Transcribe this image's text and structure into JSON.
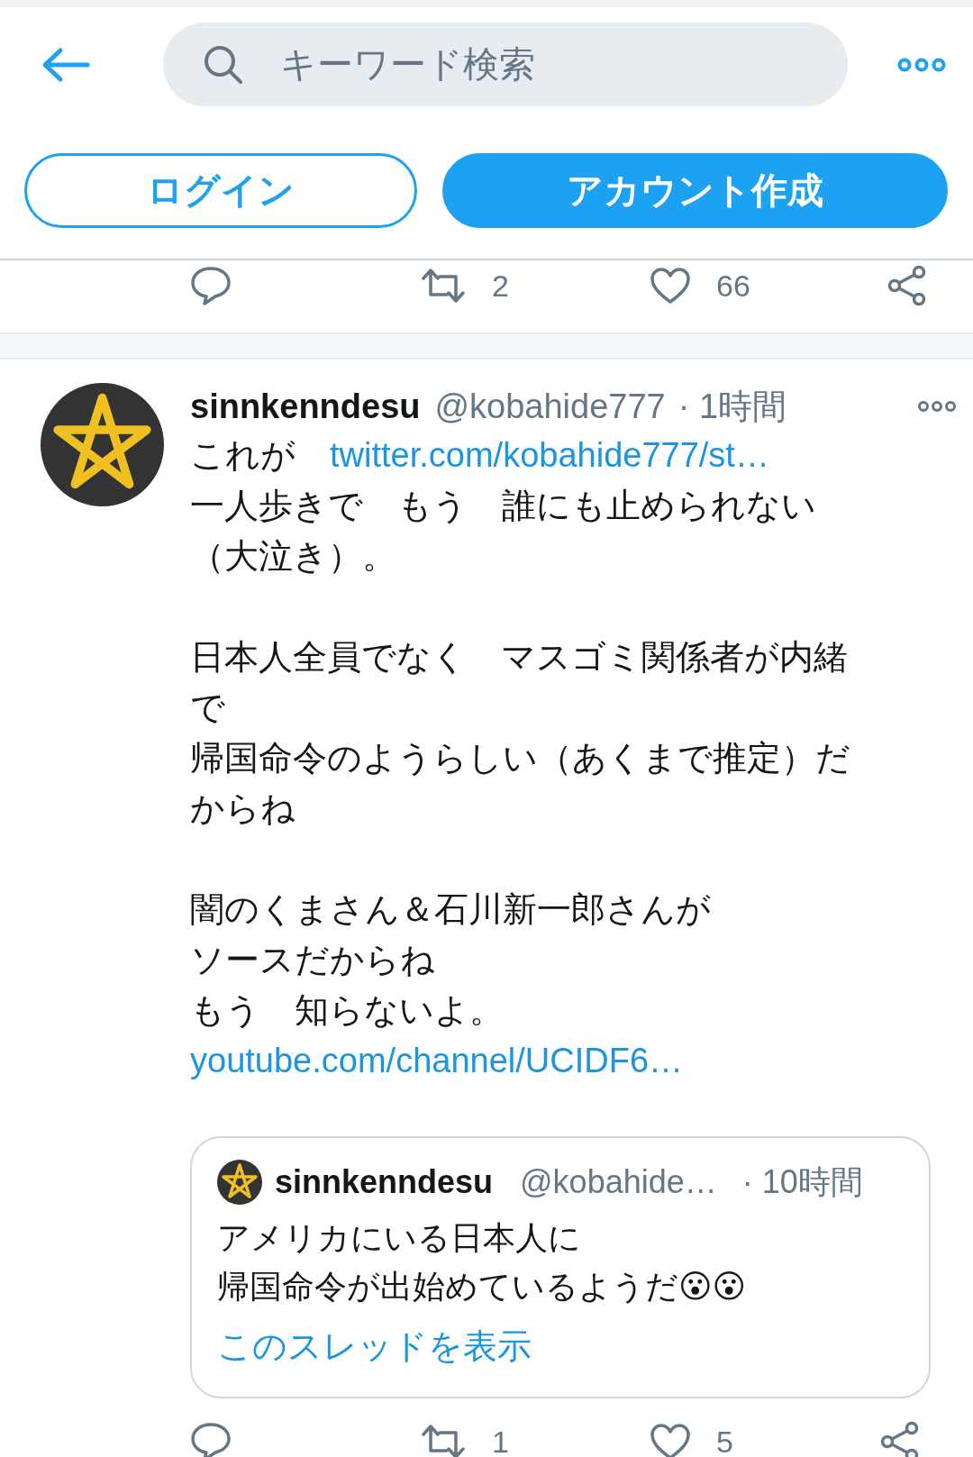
{
  "search": {
    "placeholder": "キーワード検索"
  },
  "buttons": [
    {
      "label": "ログイン",
      "kind": "outline"
    },
    {
      "label": "アカウント作成",
      "kind": "filled"
    }
  ],
  "previous_actions": {
    "retweet_count": "2",
    "like_count": "66"
  },
  "tweet": {
    "name": "sinnkenndesu",
    "handle": "@kobahide777",
    "time": "· 1時間",
    "paragraphs": [
      [
        [
          {
            "kind": "text",
            "text": "これが　"
          },
          {
            "kind": "link",
            "text": "twitter.com/kobahide777/st…"
          }
        ],
        [
          {
            "kind": "text",
            "text": "一人歩きで　もう　誰にも止められない"
          }
        ],
        [
          {
            "kind": "text",
            "text": "（大泣き）。"
          }
        ]
      ],
      [
        [
          {
            "kind": "text",
            "text": "日本人全員でなく　マスゴミ関係者が内緒"
          }
        ],
        [
          {
            "kind": "text",
            "text": "で"
          }
        ],
        [
          {
            "kind": "text",
            "text": "帰国命令のようらしい（あくまで推定）だ"
          }
        ],
        [
          {
            "kind": "text",
            "text": "からね"
          }
        ]
      ],
      [
        [
          {
            "kind": "text",
            "text": "闇のくまさん＆石川新一郎さんが"
          }
        ],
        [
          {
            "kind": "text",
            "text": "ソースだからね"
          }
        ],
        [
          {
            "kind": "text",
            "text": "もう　知らないよ。"
          }
        ],
        [
          {
            "kind": "link",
            "text": "youtube.com/channel/UCIDF6…"
          }
        ]
      ]
    ],
    "quote": {
      "name": "sinnkenndesu",
      "handle": "@kobahide…",
      "time": "· 10時間",
      "lines": [
        "アメリカにいる日本人に",
        "帰国命令が出始めているようだ😮😮"
      ],
      "thread_link": "このスレッドを表示"
    },
    "actions": {
      "retweet_count": "1",
      "like_count": "5"
    }
  }
}
